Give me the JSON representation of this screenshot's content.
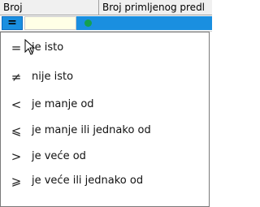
{
  "header": {
    "col1": "Broj",
    "col2": "Broj primljenog predl"
  },
  "filter_row": {
    "operator_symbol": "=",
    "value": "",
    "accent_color": "#1a8fe0"
  },
  "dropdown": {
    "options": [
      {
        "symbol": "=",
        "label": "je isto"
      },
      {
        "symbol": "≠",
        "label": "nije isto"
      },
      {
        "symbol": "<",
        "label": "je manje od"
      },
      {
        "symbol": "⩽",
        "label": "je manje ili jednako od"
      },
      {
        "symbol": ">",
        "label": "je veće od"
      },
      {
        "symbol": "⩾",
        "label": "je veće ili jednako od"
      }
    ]
  }
}
